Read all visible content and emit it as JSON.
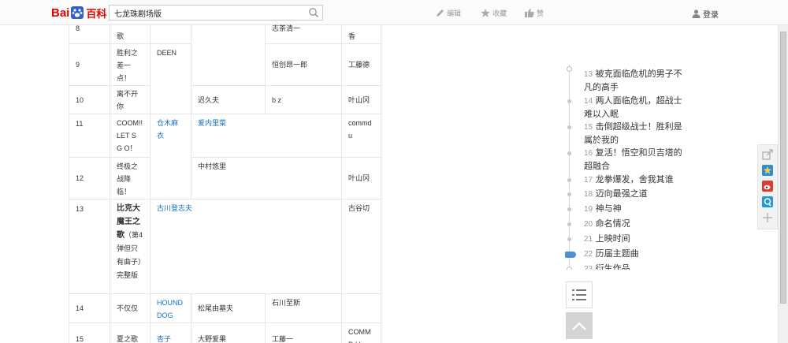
{
  "header": {
    "logo_left": "Bai",
    "logo_right": "百科",
    "search_value": "七龙珠剧场版",
    "edit_label": "编辑",
    "favorite_label": "收藏",
    "like_label": "赞",
    "login_label": "登录"
  },
  "table": {
    "rows": [
      {
        "no": "8",
        "title": "歌",
        "c3": "",
        "c4": "",
        "c5": "志茶清一",
        "c6": "香"
      },
      {
        "no": "9",
        "title": "胜利之差一点！",
        "c3": "DEEN",
        "c4": "",
        "c5": "恒创昂一郎",
        "c6": "工藤德"
      },
      {
        "no": "10",
        "title": "离不开你",
        "c3": "",
        "c4": "迟久夫",
        "c5": "b z",
        "c6": "叶山冈"
      },
      {
        "no": "11",
        "title": "COOM!! LET S G O！",
        "c3": "仓木麻衣",
        "c4": "爱内里菜",
        "c5": "",
        "c6": "commd u"
      },
      {
        "no": "12",
        "title": "终极之战降临！",
        "c3": "",
        "c4": "中村悠里",
        "c5": "",
        "c6": "叶山冈"
      },
      {
        "no": "13",
        "title": "比克大魔王之歌",
        "title_extra": "（第4弹但只有曲子）完整版",
        "c3": "古川登志夫",
        "c4": "",
        "c5": "",
        "c6": "古谷切"
      },
      {
        "no": "14",
        "title": "不仅仅",
        "c3": "HOUND DOG",
        "c4": "松尾由墓夫",
        "c5": "石川至斯",
        "c6": ""
      },
      {
        "no": "15",
        "title": "夏之歌",
        "c3": "杏子",
        "c4": "大野爱果",
        "c5": "工藤一",
        "c6": "COMMD U"
      }
    ]
  },
  "catalog": {
    "items": [
      {
        "num": "13",
        "text": "被克面临危机的男子不凡的高手"
      },
      {
        "num": "14",
        "text": "两人面临危机，超战士难以入眠"
      },
      {
        "num": "15",
        "text": "击倒超级战士！胜利是属於我的"
      },
      {
        "num": "16",
        "text": "复活！悟空和贝吉塔的超融合"
      },
      {
        "num": "17",
        "text": "龙拳爆发，舍我其谁"
      },
      {
        "num": "18",
        "text": "迈向最强之道"
      },
      {
        "num": "19",
        "text": "神与神"
      },
      {
        "num": "20",
        "text": "命名情况"
      },
      {
        "num": "21",
        "text": "上映时间"
      },
      {
        "num": "22",
        "text": "历届主题曲"
      },
      {
        "num": "23",
        "text": "衍生作品"
      }
    ]
  },
  "colors": {
    "brand_red": "#e10601",
    "link_blue": "#136ec2",
    "active_marker": "#4f8fd6"
  }
}
